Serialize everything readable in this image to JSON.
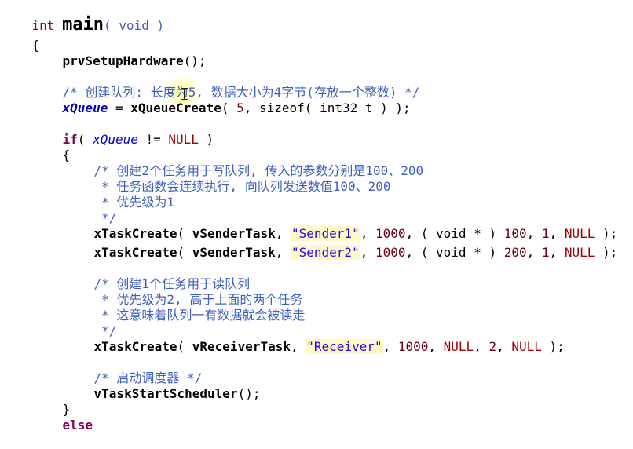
{
  "editor": {
    "code": {
      "l1": {
        "int": "int ",
        "main": "main",
        "rest": "( void )"
      },
      "l2": "{",
      "l3": {
        "fn": "prvSetupHardware",
        "rest": "();"
      },
      "l5": "/* 创建队列: 长度为5, 数据大小为4字节(存放一个整数) */",
      "l6": {
        "var": "xQueue",
        "eq": " = ",
        "fn": "xQueueCreate",
        "p1": "( ",
        "n1": "5",
        "p2": ", sizeof( int32_t ) );"
      },
      "l8": {
        "kw": "if",
        "p1": "( ",
        "var": "xQueue",
        "op": " != ",
        "null": "NULL",
        "p2": " )"
      },
      "l9": "{",
      "l10": "/* 创建2个任务用于写队列, 传入的参数分别是100、200",
      "l11": " * 任务函数会连续执行, 向队列发送数值100、200",
      "l12": " * 优先级为1",
      "l13": " */",
      "l14": {
        "fn": "xTaskCreate",
        "p1": "( ",
        "arg": "vSenderTask",
        "c1": ", ",
        "str": "\"Sender1\"",
        "c2": ", ",
        "n1": "1000",
        "c3": ", ( void * ) ",
        "n2": "100",
        "c4": ", ",
        "n3": "1",
        "c5": ", ",
        "null": "NULL",
        "end": " );"
      },
      "l15": {
        "fn": "xTaskCreate",
        "p1": "( ",
        "arg": "vSenderTask",
        "c1": ", ",
        "str": "\"Sender2\"",
        "c2": ", ",
        "n1": "1000",
        "c3": ", ( void * ) ",
        "n2": "200",
        "c4": ", ",
        "n3": "1",
        "c5": ", ",
        "null": "NULL",
        "end": " );"
      },
      "l17": "/* 创建1个任务用于读队列",
      "l18": " * 优先级为2, 高于上面的两个任务",
      "l19": " * 这意味着队列一有数据就会被读走",
      "l20": " */",
      "l21": {
        "fn": "xTaskCreate",
        "p1": "( ",
        "arg": "vReceiverTask",
        "c1": ", ",
        "str": "\"Receiver\"",
        "c2": ", ",
        "n1": "1000",
        "c3": ", ",
        "null1": "NULL",
        "c4": ", ",
        "n2": "2",
        "c5": ", ",
        "null2": "NULL",
        "end": " );"
      },
      "l23": "/* 启动调度器 */",
      "l24": {
        "fn": "vTaskStartScheduler",
        "rest": "();"
      },
      "l25": "}",
      "l26": "else"
    }
  },
  "colors": {
    "keyword": "#7f0055",
    "comment": "#3f5fbf",
    "string": "#2a00ff",
    "number": "#6b0014",
    "variable": "#0000c0",
    "string_highlight": "#fff9c4",
    "cursor_highlight": "#ffff78"
  }
}
